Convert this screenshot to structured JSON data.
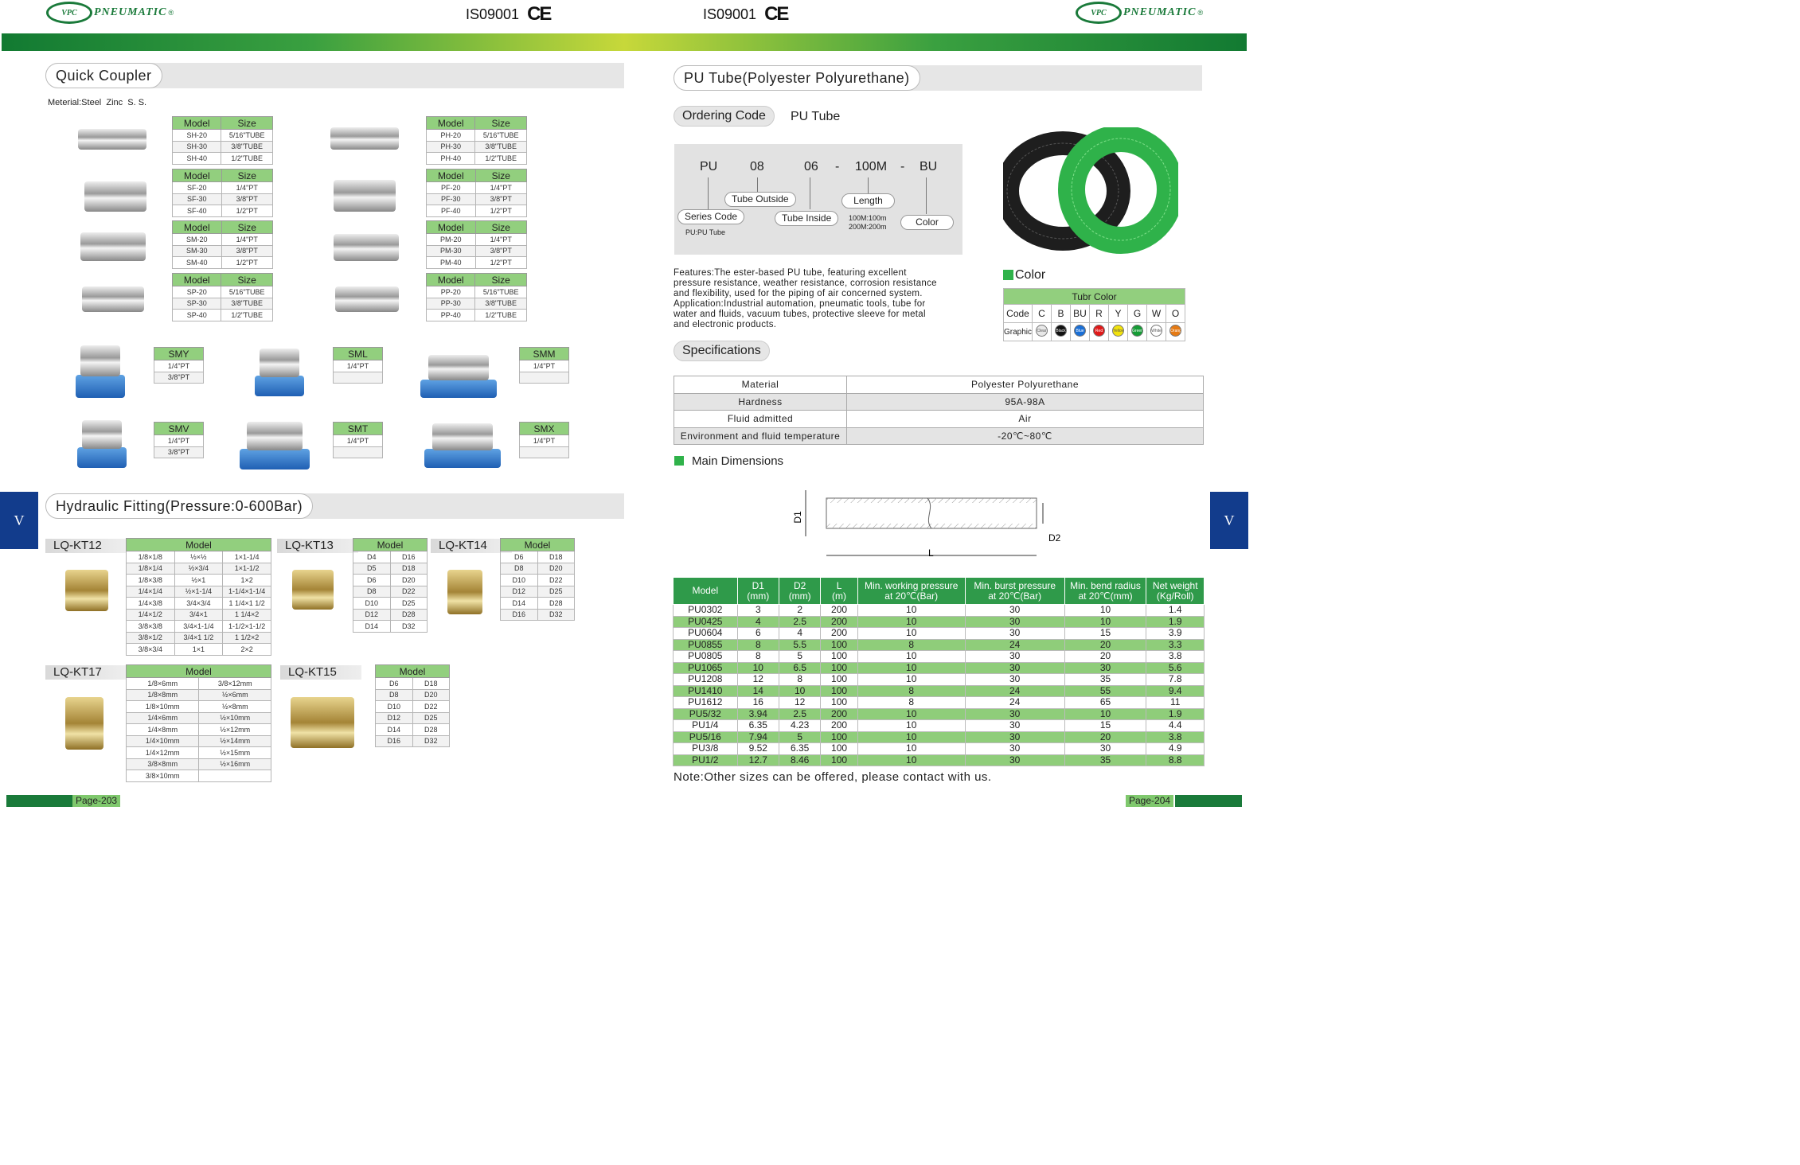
{
  "header": {
    "brand": "PNEUMATIC",
    "logo_text": "VPC",
    "reg": "®",
    "cert": "IS09001",
    "ce": "CE"
  },
  "left": {
    "quick_coupler": {
      "title": "Quick Coupler",
      "material": "Meterial:Steel  Zinc  S. S.",
      "tables": [
        {
          "h": [
            "Model",
            "Size"
          ],
          "rows": [
            [
              "SH-20",
              "5/16\"TUBE"
            ],
            [
              "SH-30",
              "3/8\"TUBE"
            ],
            [
              "SH-40",
              "1/2\"TUBE"
            ]
          ]
        },
        {
          "h": [
            "Model",
            "Size"
          ],
          "rows": [
            [
              "SF-20",
              "1/4\"PT"
            ],
            [
              "SF-30",
              "3/8\"PT"
            ],
            [
              "SF-40",
              "1/2\"PT"
            ]
          ]
        },
        {
          "h": [
            "Model",
            "Size"
          ],
          "rows": [
            [
              "SM-20",
              "1/4\"PT"
            ],
            [
              "SM-30",
              "3/8\"PT"
            ],
            [
              "SM-40",
              "1/2\"PT"
            ]
          ]
        },
        {
          "h": [
            "Model",
            "Size"
          ],
          "rows": [
            [
              "SP-20",
              "5/16\"TUBE"
            ],
            [
              "SP-30",
              "3/8\"TUBE"
            ],
            [
              "SP-40",
              "1/2\"TUBE"
            ]
          ]
        },
        {
          "h": [
            "Model",
            "Size"
          ],
          "rows": [
            [
              "PH-20",
              "5/16\"TUBE"
            ],
            [
              "PH-30",
              "3/8\"TUBE"
            ],
            [
              "PH-40",
              "1/2\"TUBE"
            ]
          ]
        },
        {
          "h": [
            "Model",
            "Size"
          ],
          "rows": [
            [
              "PF-20",
              "1/4\"PT"
            ],
            [
              "PF-30",
              "3/8\"PT"
            ],
            [
              "PF-40",
              "1/2\"PT"
            ]
          ]
        },
        {
          "h": [
            "Model",
            "Size"
          ],
          "rows": [
            [
              "PM-20",
              "1/4\"PT"
            ],
            [
              "PM-30",
              "3/8\"PT"
            ],
            [
              "PM-40",
              "1/2\"PT"
            ]
          ]
        },
        {
          "h": [
            "Model",
            "Size"
          ],
          "rows": [
            [
              "PP-20",
              "5/16\"TUBE"
            ],
            [
              "PP-30",
              "3/8\"TUBE"
            ],
            [
              "PP-40",
              "1/2\"TUBE"
            ]
          ]
        }
      ],
      "manifolds": [
        {
          "h": "SMY",
          "rows": [
            "1/4\"PT",
            "3/8\"PT"
          ]
        },
        {
          "h": "SML",
          "rows": [
            "1/4\"PT",
            ""
          ]
        },
        {
          "h": "SMM",
          "rows": [
            "1/4\"PT",
            ""
          ]
        },
        {
          "h": "SMV",
          "rows": [
            "1/4\"PT",
            "3/8\"PT"
          ]
        },
        {
          "h": "SMT",
          "rows": [
            "1/4\"PT",
            ""
          ]
        },
        {
          "h": "SMX",
          "rows": [
            "1/4\"PT",
            ""
          ]
        }
      ]
    },
    "hydraulic": {
      "title": "Hydraulic Fitting(Pressure:0-600Bar)",
      "kt12": {
        "label": "LQ-KT12",
        "h": "Model",
        "rows": [
          [
            "1/8×1/8",
            "½×½",
            "1×1-1/4"
          ],
          [
            "1/8×1/4",
            "½×3/4",
            "1×1-1/2"
          ],
          [
            "1/8×3/8",
            "½×1",
            "1×2"
          ],
          [
            "1/4×1/4",
            "½×1-1/4",
            "1-1/4×1-1/4"
          ],
          [
            "1/4×3/8",
            "3/4×3/4",
            "1 1/4×1 1/2"
          ],
          [
            "1/4×1/2",
            "3/4×1",
            "1 1/4×2"
          ],
          [
            "3/8×3/8",
            "3/4×1-1/4",
            "1-1/2×1-1/2"
          ],
          [
            "3/8×1/2",
            "3/4×1 1/2",
            "1 1/2×2"
          ],
          [
            "3/8×3/4",
            "1×1",
            "2×2"
          ]
        ]
      },
      "kt13": {
        "label": "LQ-KT13",
        "h": "Model",
        "rows": [
          [
            "D4",
            "D16"
          ],
          [
            "D5",
            "D18"
          ],
          [
            "D6",
            "D20"
          ],
          [
            "D8",
            "D22"
          ],
          [
            "D10",
            "D25"
          ],
          [
            "D12",
            "D28"
          ],
          [
            "D14",
            "D32"
          ]
        ]
      },
      "kt14": {
        "label": "LQ-KT14",
        "h": "Model",
        "rows": [
          [
            "D6",
            "D18"
          ],
          [
            "D8",
            "D20"
          ],
          [
            "D10",
            "D22"
          ],
          [
            "D12",
            "D25"
          ],
          [
            "D14",
            "D28"
          ],
          [
            "D16",
            "D32"
          ]
        ]
      },
      "kt17": {
        "label": "LQ-KT17",
        "h": "Model",
        "rows": [
          [
            "1/8×6mm",
            "3/8×12mm"
          ],
          [
            "1/8×8mm",
            "½×6mm"
          ],
          [
            "1/8×10mm",
            "½×8mm"
          ],
          [
            "1/4×6mm",
            "½×10mm"
          ],
          [
            "1/4×8mm",
            "½×12mm"
          ],
          [
            "1/4×10mm",
            "½×14mm"
          ],
          [
            "1/4×12mm",
            "½×15mm"
          ],
          [
            "3/8×8mm",
            "½×16mm"
          ],
          [
            "3/8×10mm",
            ""
          ]
        ]
      },
      "kt15": {
        "label": "LQ-KT15",
        "h": "Model",
        "rows": [
          [
            "D6",
            "D18"
          ],
          [
            "D8",
            "D20"
          ],
          [
            "D10",
            "D22"
          ],
          [
            "D12",
            "D25"
          ],
          [
            "D14",
            "D28"
          ],
          [
            "D16",
            "D32"
          ]
        ]
      }
    },
    "side_tab": "V",
    "page": "Page-203"
  },
  "right": {
    "title": "PU Tube(Polyester Polyurethane)",
    "ordering_label": "Ordering Code",
    "ordering_sub": "PU Tube",
    "code": {
      "pu": "PU",
      "od": "08",
      "id": "06",
      "dash1": "-",
      "len": "100M",
      "dash2": "-",
      "col": "BU",
      "series": "Series Code",
      "series_note": "PU:PU Tube",
      "outside": "Tube Outside",
      "inside": "Tube Inside",
      "length": "Length",
      "len_note1": "100M:100m",
      "len_note2": "200M:200m",
      "color": "Color"
    },
    "features": [
      "Features:The ester-based PU tube, featuring excellent",
      "pressure resistance, weather resistance, corrosion resistance",
      "and flexibility, used for the piping of air concerned system.",
      "Application:Industrial automation, pneumatic tools, tube for",
      "water and fluids, vacuum tubes, protective sleeve for metal",
      "and electronic products."
    ],
    "color_section": {
      "title": "Color",
      "table_title": "Tubr Color",
      "code_label": "Code",
      "graphic_label": "Graphic",
      "codes": [
        "C",
        "B",
        "BU",
        "R",
        "Y",
        "G",
        "W",
        "O"
      ],
      "graphics": [
        "Clear",
        "Black",
        "Blue",
        "Red",
        "Yellow",
        "Green",
        "White",
        "Orange"
      ],
      "colors": [
        "#e8e8e8",
        "#111111",
        "#1a6fd6",
        "#e01919",
        "#f2e20c",
        "#169c36",
        "#ffffff",
        "#e57a14"
      ]
    },
    "spec_title": "Specifications",
    "specs": [
      [
        "Material",
        "Polyester Polyurethane"
      ],
      [
        "Hardness",
        "95A-98A"
      ],
      [
        "Fluid admitted",
        "Air"
      ],
      [
        "Environment and fluid temperature",
        "-20℃~80℃"
      ]
    ],
    "dim_title": "Main Dimensions",
    "dim_labels": {
      "d1": "D1",
      "d2": "D2",
      "l": "L"
    },
    "dim_headers": [
      "Model",
      "D1\n(mm)",
      "D2\n(mm)",
      "L\n(m)",
      "Min. working pressure\nat 20℃(Bar)",
      "Min. burst pressure\nat 20℃(Bar)",
      "Min. bend radius\nat 20℃(mm)",
      "Net weight\n(Kg/Roll)"
    ],
    "dims": [
      [
        "PU0302",
        "3",
        "2",
        "200",
        "10",
        "30",
        "10",
        "1.4"
      ],
      [
        "PU0425",
        "4",
        "2.5",
        "200",
        "10",
        "30",
        "10",
        "1.9"
      ],
      [
        "PU0604",
        "6",
        "4",
        "200",
        "10",
        "30",
        "15",
        "3.9"
      ],
      [
        "PU0855",
        "8",
        "5.5",
        "100",
        "8",
        "24",
        "20",
        "3.3"
      ],
      [
        "PU0805",
        "8",
        "5",
        "100",
        "10",
        "30",
        "20",
        "3.8"
      ],
      [
        "PU1065",
        "10",
        "6.5",
        "100",
        "10",
        "30",
        "30",
        "5.6"
      ],
      [
        "PU1208",
        "12",
        "8",
        "100",
        "10",
        "30",
        "35",
        "7.8"
      ],
      [
        "PU1410",
        "14",
        "10",
        "100",
        "8",
        "24",
        "55",
        "9.4"
      ],
      [
        "PU1612",
        "16",
        "12",
        "100",
        "8",
        "24",
        "65",
        "11"
      ],
      [
        "PU5/32",
        "3.94",
        "2.5",
        "200",
        "10",
        "30",
        "10",
        "1.9"
      ],
      [
        "PU1/4",
        "6.35",
        "4.23",
        "200",
        "10",
        "30",
        "15",
        "4.4"
      ],
      [
        "PU5/16",
        "7.94",
        "5",
        "100",
        "10",
        "30",
        "20",
        "3.8"
      ],
      [
        "PU3/8",
        "9.52",
        "6.35",
        "100",
        "10",
        "30",
        "30",
        "4.9"
      ],
      [
        "PU1/2",
        "12.7",
        "8.46",
        "100",
        "10",
        "30",
        "35",
        "8.8"
      ]
    ],
    "note": "Note:Other sizes can be offered, please contact with us.",
    "side_tab": "V",
    "page": "Page-204"
  }
}
